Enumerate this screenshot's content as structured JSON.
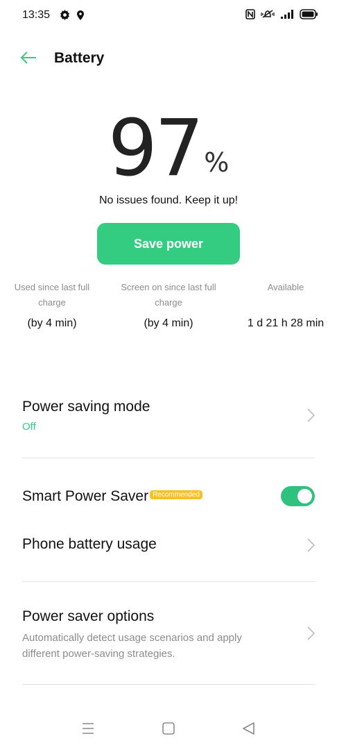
{
  "status_bar": {
    "time": "13:35",
    "left_icons": [
      "gear-icon",
      "location-pin-icon"
    ],
    "right_icons": [
      "nfc-icon",
      "vibrate-icon",
      "signal-icon",
      "battery-icon"
    ]
  },
  "header": {
    "back_icon": "back-arrow-icon",
    "title": "Battery"
  },
  "battery": {
    "percent": "97",
    "percent_sign": "%",
    "message": "No issues found. Keep it up!"
  },
  "save_button": {
    "label": "Save power"
  },
  "stats": [
    {
      "label_line1": "Used since last full",
      "label_line2": "charge",
      "value": "(by 4 min)"
    },
    {
      "label_line1": "Screen on since last full",
      "label_line2": "charge",
      "value": "(by 4 min)"
    },
    {
      "label_line1": "Available",
      "label_line2": "",
      "value": "1 d 21 h 28 min"
    }
  ],
  "settings": {
    "power_saving_mode": {
      "title": "Power saving mode",
      "value": "Off"
    },
    "smart_power_saver": {
      "title": "Smart Power Saver",
      "badge": "Recommended",
      "enabled": true
    },
    "phone_battery_usage": {
      "title": "Phone battery usage"
    },
    "power_saver_options": {
      "title": "Power saver options",
      "description_line1": "Automatically detect usage scenarios and apply",
      "description_line2": "different power-saving strategies."
    }
  },
  "colors": {
    "accent": "#34cc80",
    "toggle_on": "#2ec27e",
    "badge": "#f5c226",
    "secondary_text": "#8c8c8c"
  },
  "nav_bar": [
    "menu-icon",
    "home-icon",
    "back-icon"
  ]
}
